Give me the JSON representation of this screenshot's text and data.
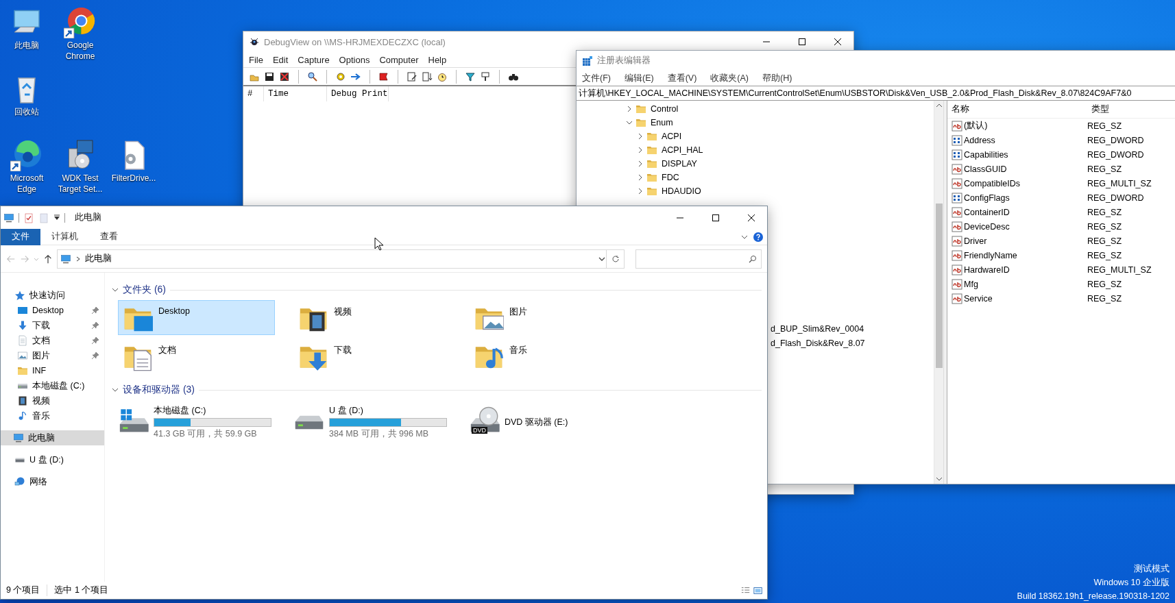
{
  "desktop": {
    "icons": [
      {
        "label": "此电脑",
        "kind": "pc",
        "shortcut": false
      },
      {
        "label": "Google Chrome",
        "kind": "chrome",
        "shortcut": true
      },
      {
        "label": "回收站",
        "kind": "recycle",
        "shortcut": false
      },
      {
        "label": "Microsoft Edge",
        "kind": "edge",
        "shortcut": true
      },
      {
        "label": "WDK Test Target Set...",
        "kind": "installer",
        "shortcut": false
      },
      {
        "label": "FilterDrive...",
        "kind": "file",
        "shortcut": false
      }
    ],
    "test_mode_text": [
      "测试模式",
      "Windows 10 企业版",
      "Build 18362.19h1_release.190318-1202"
    ]
  },
  "debugview": {
    "title": "DebugView on \\\\MS-HRJMEXDECZXC (local)",
    "menu": [
      "File",
      "Edit",
      "Capture",
      "Options",
      "Computer",
      "Help"
    ],
    "columns": [
      "#",
      "Time",
      "Debug Print"
    ]
  },
  "regedit": {
    "title": "注册表编辑器",
    "menu": [
      "文件(F)",
      "编辑(E)",
      "查看(V)",
      "收藏夹(A)",
      "帮助(H)"
    ],
    "address": "计算机\\HKEY_LOCAL_MACHINE\\SYSTEM\\CurrentControlSet\\Enum\\USBSTOR\\Disk&Ven_USB_2.0&Prod_Flash_Disk&Rev_8.07\\824C9AF7&0",
    "tree": [
      {
        "label": "Control",
        "expanded": false
      },
      {
        "label": "Enum",
        "expanded": true,
        "children": [
          {
            "label": "ACPI",
            "expanded": false
          },
          {
            "label": "ACPI_HAL",
            "expanded": false
          },
          {
            "label": "DISPLAY",
            "expanded": false
          },
          {
            "label": "FDC",
            "expanded": false
          },
          {
            "label": "HDAUDIO",
            "expanded": false
          }
        ]
      }
    ],
    "tree_cut_rows": [
      "d_BUP_Slim&Rev_0004",
      "d_Flash_Disk&Rev_8.07"
    ],
    "value_columns": [
      "名称",
      "类型"
    ],
    "values": [
      {
        "name": "(默认)",
        "type": "REG_SZ",
        "kind": "string"
      },
      {
        "name": "Address",
        "type": "REG_DWORD",
        "kind": "binary"
      },
      {
        "name": "Capabilities",
        "type": "REG_DWORD",
        "kind": "binary"
      },
      {
        "name": "ClassGUID",
        "type": "REG_SZ",
        "kind": "string"
      },
      {
        "name": "CompatibleIDs",
        "type": "REG_MULTI_SZ",
        "kind": "string"
      },
      {
        "name": "ConfigFlags",
        "type": "REG_DWORD",
        "kind": "binary"
      },
      {
        "name": "ContainerID",
        "type": "REG_SZ",
        "kind": "string"
      },
      {
        "name": "DeviceDesc",
        "type": "REG_SZ",
        "kind": "string"
      },
      {
        "name": "Driver",
        "type": "REG_SZ",
        "kind": "string"
      },
      {
        "name": "FriendlyName",
        "type": "REG_SZ",
        "kind": "string"
      },
      {
        "name": "HardwareID",
        "type": "REG_MULTI_SZ",
        "kind": "string"
      },
      {
        "name": "Mfg",
        "type": "REG_SZ",
        "kind": "string"
      },
      {
        "name": "Service",
        "type": "REG_SZ",
        "kind": "string"
      }
    ]
  },
  "explorer": {
    "title": "此电脑",
    "ribbon_tabs": [
      {
        "label": "文件",
        "selected": true
      },
      {
        "label": "计算机",
        "selected": false
      },
      {
        "label": "查看",
        "selected": false
      }
    ],
    "address": "此电脑",
    "nav": [
      {
        "label": "快速访问",
        "kind": "star",
        "selected": false,
        "children": [
          {
            "label": "Desktop",
            "kind": "desktop",
            "pinned": true,
            "selected": false
          },
          {
            "label": "下载",
            "kind": "download",
            "pinned": true,
            "selected": false
          },
          {
            "label": "文档",
            "kind": "document",
            "pinned": true,
            "selected": false
          },
          {
            "label": "图片",
            "kind": "picture",
            "pinned": true,
            "selected": false
          },
          {
            "label": "INF",
            "kind": "folder",
            "pinned": false,
            "selected": false
          },
          {
            "label": "本地磁盘 (C:)",
            "kind": "drive",
            "pinned": false,
            "selected": false
          },
          {
            "label": "视频",
            "kind": "video",
            "pinned": false,
            "selected": false
          },
          {
            "label": "音乐",
            "kind": "music",
            "pinned": false,
            "selected": false
          }
        ]
      },
      {
        "label": "此电脑",
        "kind": "pc",
        "selected": true
      },
      {
        "label": "U 盘 (D:)",
        "kind": "usb",
        "selected": false
      },
      {
        "label": "网络",
        "kind": "network",
        "selected": false
      }
    ],
    "groups": [
      {
        "title": "文件夹 (6)",
        "expanded": true,
        "kind": "folders",
        "items": [
          {
            "label": "Desktop",
            "kind": "desktop",
            "selected": true
          },
          {
            "label": "视频",
            "kind": "video",
            "selected": false
          },
          {
            "label": "图片",
            "kind": "picture",
            "selected": false
          },
          {
            "label": "文档",
            "kind": "document",
            "selected": false
          },
          {
            "label": "下载",
            "kind": "download",
            "selected": false
          },
          {
            "label": "音乐",
            "kind": "music",
            "selected": false
          }
        ]
      },
      {
        "title": "设备和驱动器 (3)",
        "expanded": true,
        "kind": "drives",
        "items": [
          {
            "label": "本地磁盘 (C:)",
            "kind": "system",
            "level": 0.31,
            "detail": "41.3 GB 可用，共 59.9 GB"
          },
          {
            "label": "U 盘 (D:)",
            "kind": "removable",
            "level": 0.61,
            "detail": "384 MB 可用，共 996 MB"
          },
          {
            "label": "DVD 驱动器 (E:)",
            "kind": "dvd",
            "badge": "DVD"
          }
        ]
      }
    ],
    "status": [
      "9 个项目",
      "选中 1 个项目"
    ]
  }
}
